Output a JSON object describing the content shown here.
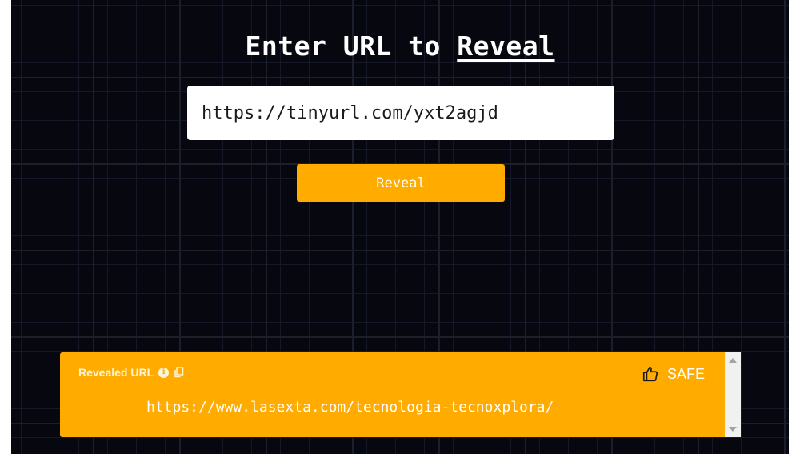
{
  "header": {
    "title_prefix": "Enter URL to ",
    "title_accent": "Reveal"
  },
  "form": {
    "url_value": "https://tinyurl.com/yxt2agjd",
    "reveal_label": "Reveal"
  },
  "result": {
    "label": "Revealed URL",
    "status": "SAFE",
    "url": "https://www.lasexta.com/tecnologia-tecnoxplora/"
  },
  "icons": {
    "info": "info-icon",
    "copy": "copy-icon",
    "thumbs_up": "thumbs-up-icon"
  },
  "colors": {
    "background": "#06070f",
    "accent": "#ffab00",
    "text": "#ffffff"
  }
}
